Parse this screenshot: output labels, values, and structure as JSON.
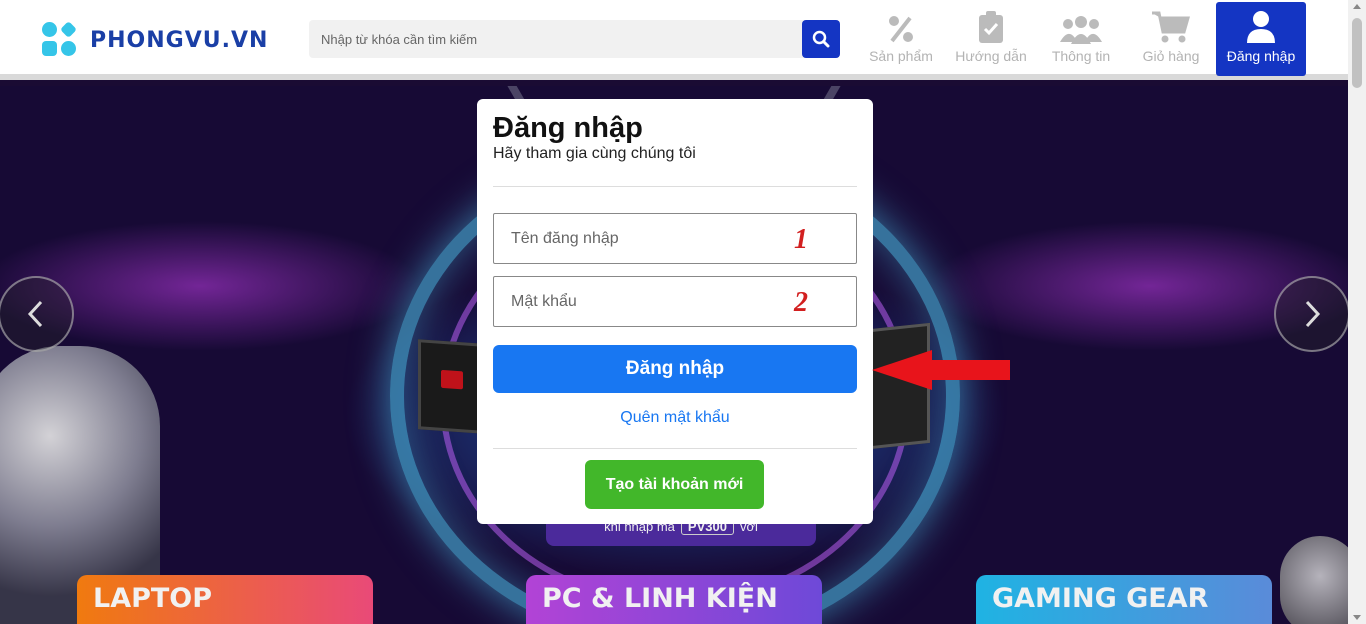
{
  "header": {
    "logo_text": "PHONGVU.VN",
    "search": {
      "placeholder": "Nhập từ khóa cần tìm kiếm",
      "value": ""
    },
    "nav": [
      {
        "label": "Sản phẩm",
        "icon": "percent-icon"
      },
      {
        "label": "Hướng dẫn",
        "icon": "clipboard-check-icon"
      },
      {
        "label": "Thông tin",
        "icon": "users-icon"
      },
      {
        "label": "Giỏ hàng",
        "icon": "cart-icon"
      },
      {
        "label": "Đăng nhập",
        "icon": "user-icon"
      }
    ],
    "accent_color": "#1435c3"
  },
  "banner": {
    "promo_text": "khi nhập mã",
    "promo_code": "PV300",
    "promo_suffix": "với",
    "categories": [
      "LAPTOP",
      "PC & LINH KIỆN",
      "GAMING GEAR"
    ]
  },
  "login_modal": {
    "title": "Đăng nhập",
    "subtitle": "Hãy tham gia cùng chúng tôi",
    "username": {
      "placeholder": "Tên đăng nhập",
      "value": "",
      "marker": "1"
    },
    "password": {
      "placeholder": "Mật khẩu",
      "value": "",
      "marker": "2"
    },
    "submit_label": "Đăng nhập",
    "forgot_label": "Quên mật khẩu",
    "create_label": "Tạo tài khoản mới",
    "primary_color": "#1877f2",
    "create_color": "#42b72a"
  }
}
